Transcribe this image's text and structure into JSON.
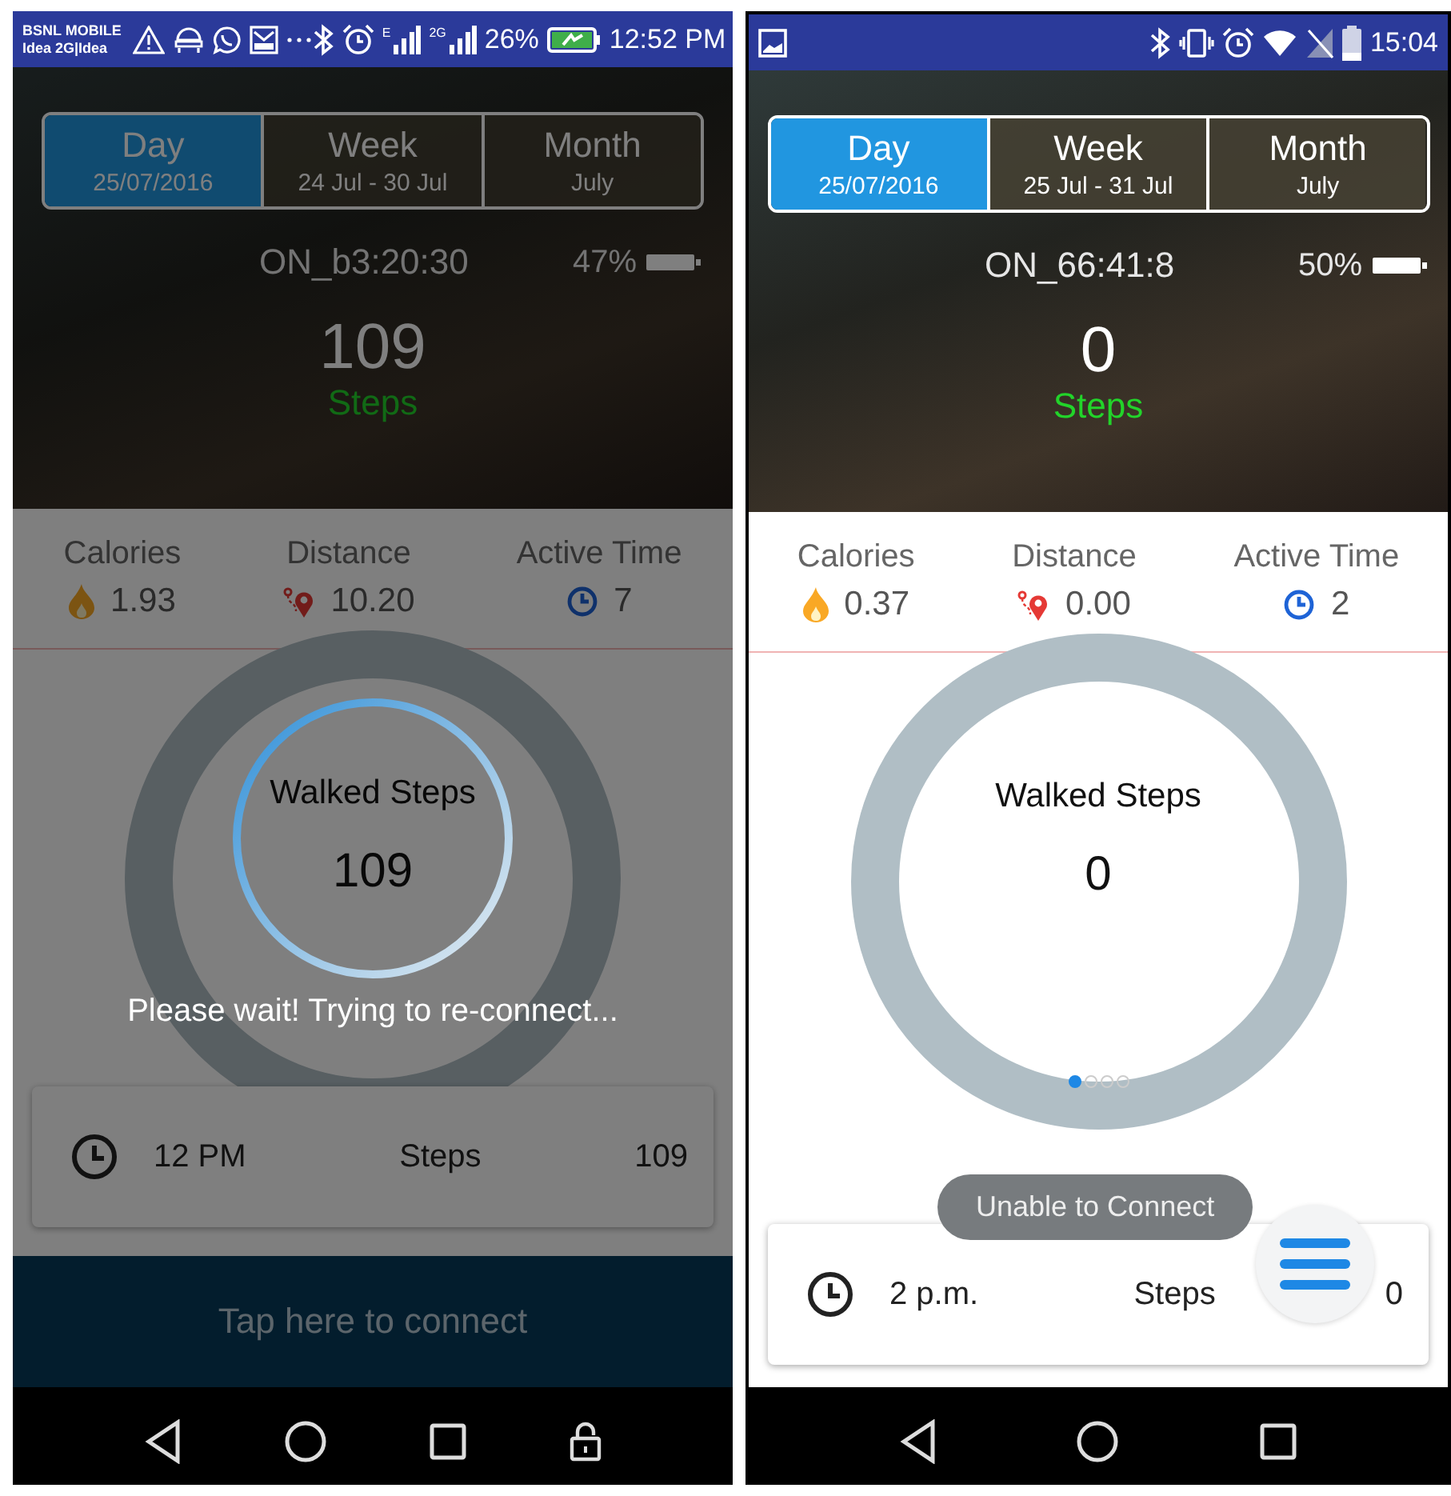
{
  "phones": [
    {
      "status_bar": {
        "carrier": "BSNL MOBILE",
        "network": "Idea 2G|Idea",
        "left_icons": [
          {
            "kind": "warning"
          },
          {
            "kind": "android"
          },
          {
            "kind": "whatsapp"
          },
          {
            "kind": "mail"
          },
          {
            "kind": "more"
          }
        ],
        "right_icons": [
          {
            "kind": "bluetooth"
          },
          {
            "kind": "alarm"
          },
          {
            "kind": "signal",
            "label": "E"
          },
          {
            "kind": "signal",
            "label": "2G"
          }
        ],
        "battery": "26%",
        "battery_charging": true,
        "time": "12:52 PM"
      },
      "tabs": [
        {
          "label": "Day",
          "sublabel": "25/07/2016",
          "selected": true
        },
        {
          "label": "Week",
          "sublabel": "24 Jul - 30 Jul",
          "selected": false
        },
        {
          "label": "Month",
          "sublabel": "July",
          "selected": false
        }
      ],
      "device": "ON_b3:20:30",
      "device_battery": "47%",
      "steps": "109",
      "steps_label": "Steps",
      "stats": [
        {
          "kind": "calories",
          "label": "Calories",
          "value": "1.93"
        },
        {
          "kind": "distance",
          "label": "Distance",
          "value": "10.20"
        },
        {
          "kind": "active_time",
          "label": "Active Time",
          "value": "7"
        }
      ],
      "ring": {
        "title": "Walked Steps",
        "value": "109"
      },
      "hour_card": {
        "time": "12 PM",
        "label": "Steps",
        "value": "109"
      },
      "connect_bar": "Tap here to connect",
      "dialog": {
        "message": "Please wait! Trying to re-connect..."
      },
      "nav_buttons": [
        {
          "kind": "back"
        },
        {
          "kind": "home"
        },
        {
          "kind": "recents"
        },
        {
          "kind": "lock"
        }
      ]
    },
    {
      "status_bar": {
        "left_icons": [
          {
            "kind": "image"
          }
        ],
        "right_icons": [
          {
            "kind": "bluetooth"
          },
          {
            "kind": "vibrate"
          },
          {
            "kind": "alarm"
          },
          {
            "kind": "wifi"
          },
          {
            "kind": "no-sim"
          }
        ],
        "battery_charging": false,
        "time": "15:04"
      },
      "tabs": [
        {
          "label": "Day",
          "sublabel": "25/07/2016",
          "selected": true
        },
        {
          "label": "Week",
          "sublabel": "25 Jul - 31 Jul",
          "selected": false
        },
        {
          "label": "Month",
          "sublabel": "July",
          "selected": false
        }
      ],
      "device": "ON_66:41:8",
      "device_battery": "50%",
      "steps": "0",
      "steps_label": "Steps",
      "stats": [
        {
          "kind": "calories",
          "label": "Calories",
          "value": "0.37"
        },
        {
          "kind": "distance",
          "label": "Distance",
          "value": "0.00"
        },
        {
          "kind": "active_time",
          "label": "Active Time",
          "value": "2"
        }
      ],
      "ring": {
        "title": "Walked Steps",
        "value": "0"
      },
      "page_dots": [
        {
          "selected": true
        },
        {
          "selected": false
        },
        {
          "selected": false
        },
        {
          "selected": false
        }
      ],
      "toast": "Unable to Connect",
      "hour_card": {
        "time": "2 p.m.",
        "label": "Steps",
        "value": "0"
      },
      "fab": true,
      "nav_buttons": [
        {
          "kind": "back"
        },
        {
          "kind": "home"
        },
        {
          "kind": "recents"
        }
      ]
    }
  ]
}
